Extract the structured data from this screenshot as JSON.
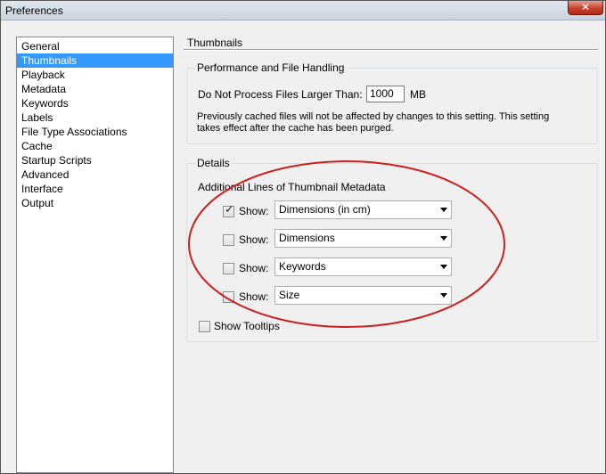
{
  "window": {
    "title": "Preferences",
    "close_symbol": "✕"
  },
  "sidebar": {
    "items": [
      {
        "label": "General",
        "selected": false
      },
      {
        "label": "Thumbnails",
        "selected": true
      },
      {
        "label": "Playback",
        "selected": false
      },
      {
        "label": "Metadata",
        "selected": false
      },
      {
        "label": "Keywords",
        "selected": false
      },
      {
        "label": "Labels",
        "selected": false
      },
      {
        "label": "File Type Associations",
        "selected": false
      },
      {
        "label": "Cache",
        "selected": false
      },
      {
        "label": "Startup Scripts",
        "selected": false
      },
      {
        "label": "Advanced",
        "selected": false
      },
      {
        "label": "Interface",
        "selected": false
      },
      {
        "label": "Output",
        "selected": false
      }
    ]
  },
  "main": {
    "title": "Thumbnails",
    "performance": {
      "heading": "Performance and File Handling",
      "limit_label": "Do Not Process Files Larger Than:",
      "limit_value": "1000",
      "limit_unit": "MB",
      "note": "Previously cached files will not be affected by changes to this setting. This setting takes effect after the cache has been purged."
    },
    "details": {
      "heading": "Details",
      "subheading": "Additional Lines of Thumbnail Metadata",
      "show_label": "Show:",
      "rows": [
        {
          "checked": true,
          "value": "Dimensions (in cm)"
        },
        {
          "checked": false,
          "value": "Dimensions"
        },
        {
          "checked": false,
          "value": "Keywords"
        },
        {
          "checked": false,
          "value": "Size"
        }
      ],
      "tooltips_label": "Show Tooltips",
      "tooltips_checked": false
    }
  },
  "colors": {
    "selection": "#3399ff",
    "annotation": "#cc1f1f"
  }
}
